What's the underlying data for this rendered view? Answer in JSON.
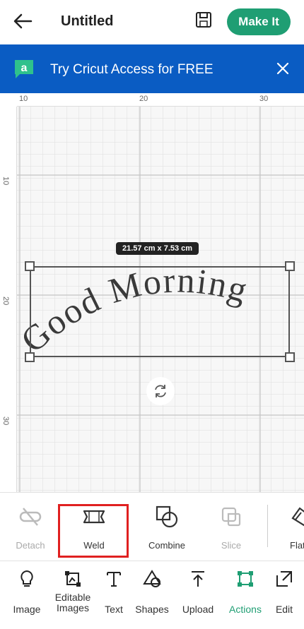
{
  "header": {
    "title": "Untitled",
    "make_it_label": "Make It"
  },
  "banner": {
    "text": "Try Cricut Access for FREE",
    "logo_letter": "a"
  },
  "canvas": {
    "ruler_top": [
      "10",
      "20",
      "30"
    ],
    "ruler_left": [
      "10",
      "20",
      "30"
    ],
    "size_badge": "21.57 cm x 7.53 cm",
    "artwork_text": "Good Morning"
  },
  "actions": [
    {
      "label": "Detach",
      "icon": "detach-icon",
      "enabled": false
    },
    {
      "label": "Weld",
      "icon": "weld-icon",
      "enabled": true,
      "highlighted": true
    },
    {
      "label": "Combine",
      "icon": "combine-icon",
      "enabled": true
    },
    {
      "label": "Slice",
      "icon": "slice-icon",
      "enabled": false
    },
    {
      "label": "Flat",
      "icon": "flatten-icon",
      "enabled": true
    }
  ],
  "bottom_nav": [
    {
      "label": "Image",
      "icon": "lightbulb-icon"
    },
    {
      "label": "Editable Images",
      "icon": "editable-image-icon"
    },
    {
      "label": "Text",
      "icon": "text-icon"
    },
    {
      "label": "Shapes",
      "icon": "shapes-icon"
    },
    {
      "label": "Upload",
      "icon": "upload-icon"
    },
    {
      "label": "Actions",
      "icon": "actions-icon",
      "active": true
    },
    {
      "label": "Edit",
      "icon": "edit-icon"
    }
  ],
  "colors": {
    "accent": "#1f9e73",
    "banner": "#0a5cc3",
    "highlight": "#e02020"
  }
}
